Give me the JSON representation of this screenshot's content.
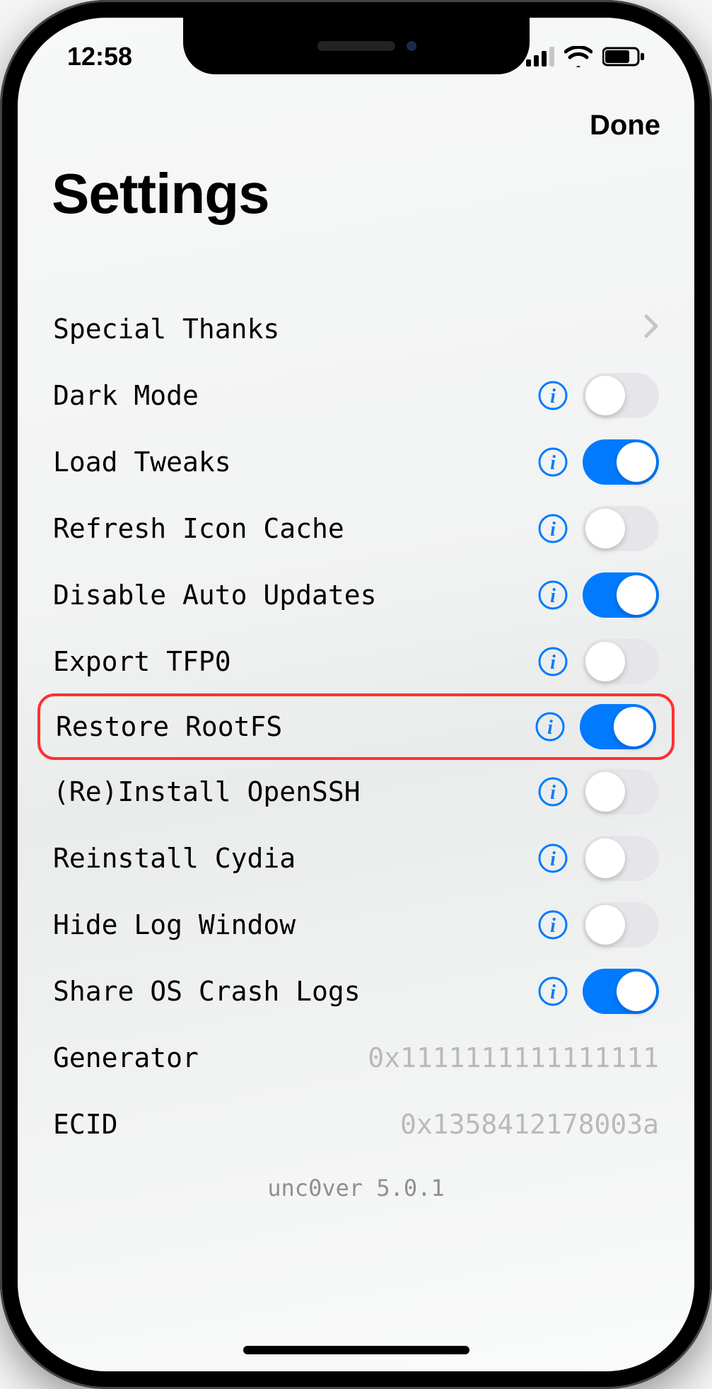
{
  "statusbar": {
    "time": "12:58"
  },
  "nav": {
    "done": "Done"
  },
  "title": "Settings",
  "rows": {
    "special_thanks": {
      "label": "Special Thanks"
    },
    "dark_mode": {
      "label": "Dark Mode",
      "on": false
    },
    "load_tweaks": {
      "label": "Load Tweaks",
      "on": true
    },
    "refresh_icon": {
      "label": "Refresh Icon Cache",
      "on": false
    },
    "disable_updates": {
      "label": "Disable Auto Updates",
      "on": true
    },
    "export_tfp0": {
      "label": "Export TFP0",
      "on": false
    },
    "restore_rootfs": {
      "label": "Restore RootFS",
      "on": true,
      "highlighted": true
    },
    "reinstall_openssh": {
      "label": "(Re)Install OpenSSH",
      "on": false
    },
    "reinstall_cydia": {
      "label": "Reinstall Cydia",
      "on": false
    },
    "hide_log": {
      "label": "Hide Log Window",
      "on": false
    },
    "share_crash": {
      "label": "Share OS Crash Logs",
      "on": true
    },
    "generator": {
      "label": "Generator",
      "value": "0x1111111111111111"
    },
    "ecid": {
      "label": "ECID",
      "value": "0x1358412178003a"
    }
  },
  "footer": {
    "version": "unc0ver 5.0.1"
  }
}
